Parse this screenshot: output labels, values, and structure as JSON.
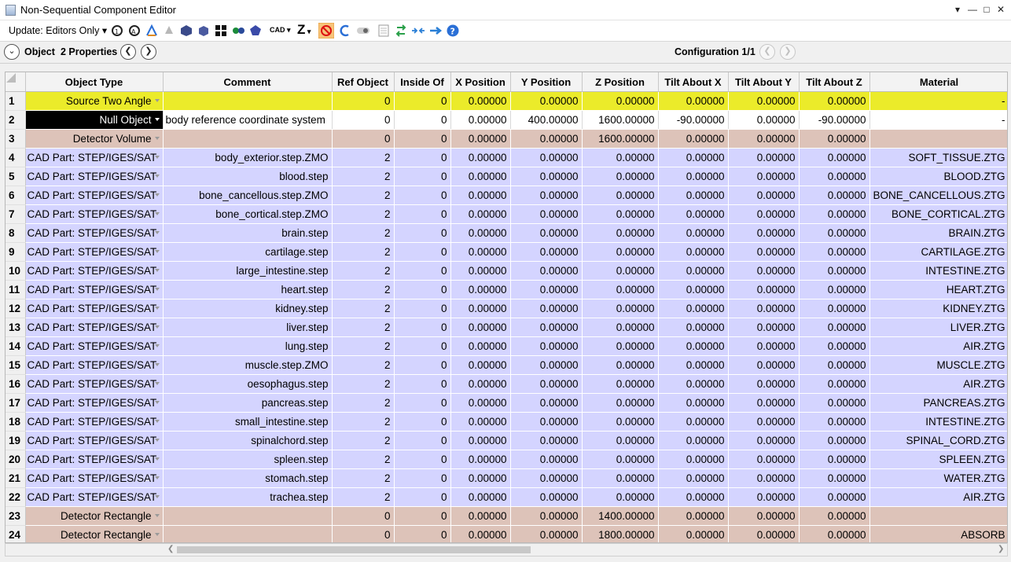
{
  "window": {
    "title": "Non-Sequential Component Editor"
  },
  "toolbar": {
    "update_label": "Update: Editors Only",
    "cad_label": "CAD",
    "z_label": "Z"
  },
  "configbar": {
    "object_label": "Object",
    "properties_label": "2 Properties",
    "configuration": "Configuration 1/1"
  },
  "columns": [
    "Object Type",
    "Comment",
    "Ref Object",
    "Inside Of",
    "X Position",
    "Y Position",
    "Z Position",
    "Tilt About X",
    "Tilt About Y",
    "Tilt About Z",
    "Material"
  ],
  "rows": [
    {
      "n": "1",
      "type": "Source Two Angle",
      "comment": "",
      "ref": "0",
      "inside": "0",
      "x": "0.00000",
      "y": "0.00000",
      "z": "0.00000",
      "tx": "0.00000",
      "ty": "0.00000",
      "tz": "0.00000",
      "mat": "-"
    },
    {
      "n": "2",
      "type": "Null Object",
      "comment": "body reference coordinate system",
      "ref": "0",
      "inside": "0",
      "x": "0.00000",
      "y": "400.00000",
      "z": "1600.00000",
      "tx": "-90.00000",
      "ty": "0.00000",
      "tz": "-90.00000",
      "mat": "-"
    },
    {
      "n": "3",
      "type": "Detector Volume",
      "comment": "",
      "ref": "0",
      "inside": "0",
      "x": "0.00000",
      "y": "0.00000",
      "z": "1600.00000",
      "tx": "0.00000",
      "ty": "0.00000",
      "tz": "0.00000",
      "mat": ""
    },
    {
      "n": "4",
      "type": "CAD Part: STEP/IGES/SAT",
      "comment": "body_exterior.step.ZMO",
      "ref": "2",
      "inside": "0",
      "x": "0.00000",
      "y": "0.00000",
      "z": "0.00000",
      "tx": "0.00000",
      "ty": "0.00000",
      "tz": "0.00000",
      "mat": "SOFT_TISSUE.ZTG"
    },
    {
      "n": "5",
      "type": "CAD Part: STEP/IGES/SAT",
      "comment": "blood.step",
      "ref": "2",
      "inside": "0",
      "x": "0.00000",
      "y": "0.00000",
      "z": "0.00000",
      "tx": "0.00000",
      "ty": "0.00000",
      "tz": "0.00000",
      "mat": "BLOOD.ZTG"
    },
    {
      "n": "6",
      "type": "CAD Part: STEP/IGES/SAT",
      "comment": "bone_cancellous.step.ZMO",
      "ref": "2",
      "inside": "0",
      "x": "0.00000",
      "y": "0.00000",
      "z": "0.00000",
      "tx": "0.00000",
      "ty": "0.00000",
      "tz": "0.00000",
      "mat": "BONE_CANCELLOUS.ZTG"
    },
    {
      "n": "7",
      "type": "CAD Part: STEP/IGES/SAT",
      "comment": "bone_cortical.step.ZMO",
      "ref": "2",
      "inside": "0",
      "x": "0.00000",
      "y": "0.00000",
      "z": "0.00000",
      "tx": "0.00000",
      "ty": "0.00000",
      "tz": "0.00000",
      "mat": "BONE_CORTICAL.ZTG"
    },
    {
      "n": "8",
      "type": "CAD Part: STEP/IGES/SAT",
      "comment": "brain.step",
      "ref": "2",
      "inside": "0",
      "x": "0.00000",
      "y": "0.00000",
      "z": "0.00000",
      "tx": "0.00000",
      "ty": "0.00000",
      "tz": "0.00000",
      "mat": "BRAIN.ZTG"
    },
    {
      "n": "9",
      "type": "CAD Part: STEP/IGES/SAT",
      "comment": "cartilage.step",
      "ref": "2",
      "inside": "0",
      "x": "0.00000",
      "y": "0.00000",
      "z": "0.00000",
      "tx": "0.00000",
      "ty": "0.00000",
      "tz": "0.00000",
      "mat": "CARTILAGE.ZTG"
    },
    {
      "n": "10",
      "type": "CAD Part: STEP/IGES/SAT",
      "comment": "large_intestine.step",
      "ref": "2",
      "inside": "0",
      "x": "0.00000",
      "y": "0.00000",
      "z": "0.00000",
      "tx": "0.00000",
      "ty": "0.00000",
      "tz": "0.00000",
      "mat": "INTESTINE.ZTG"
    },
    {
      "n": "11",
      "type": "CAD Part: STEP/IGES/SAT",
      "comment": "heart.step",
      "ref": "2",
      "inside": "0",
      "x": "0.00000",
      "y": "0.00000",
      "z": "0.00000",
      "tx": "0.00000",
      "ty": "0.00000",
      "tz": "0.00000",
      "mat": "HEART.ZTG"
    },
    {
      "n": "12",
      "type": "CAD Part: STEP/IGES/SAT",
      "comment": "kidney.step",
      "ref": "2",
      "inside": "0",
      "x": "0.00000",
      "y": "0.00000",
      "z": "0.00000",
      "tx": "0.00000",
      "ty": "0.00000",
      "tz": "0.00000",
      "mat": "KIDNEY.ZTG"
    },
    {
      "n": "13",
      "type": "CAD Part: STEP/IGES/SAT",
      "comment": "liver.step",
      "ref": "2",
      "inside": "0",
      "x": "0.00000",
      "y": "0.00000",
      "z": "0.00000",
      "tx": "0.00000",
      "ty": "0.00000",
      "tz": "0.00000",
      "mat": "LIVER.ZTG"
    },
    {
      "n": "14",
      "type": "CAD Part: STEP/IGES/SAT",
      "comment": "lung.step",
      "ref": "2",
      "inside": "0",
      "x": "0.00000",
      "y": "0.00000",
      "z": "0.00000",
      "tx": "0.00000",
      "ty": "0.00000",
      "tz": "0.00000",
      "mat": "AIR.ZTG"
    },
    {
      "n": "15",
      "type": "CAD Part: STEP/IGES/SAT",
      "comment": "muscle.step.ZMO",
      "ref": "2",
      "inside": "0",
      "x": "0.00000",
      "y": "0.00000",
      "z": "0.00000",
      "tx": "0.00000",
      "ty": "0.00000",
      "tz": "0.00000",
      "mat": "MUSCLE.ZTG"
    },
    {
      "n": "16",
      "type": "CAD Part: STEP/IGES/SAT",
      "comment": "oesophagus.step",
      "ref": "2",
      "inside": "0",
      "x": "0.00000",
      "y": "0.00000",
      "z": "0.00000",
      "tx": "0.00000",
      "ty": "0.00000",
      "tz": "0.00000",
      "mat": "AIR.ZTG"
    },
    {
      "n": "17",
      "type": "CAD Part: STEP/IGES/SAT",
      "comment": "pancreas.step",
      "ref": "2",
      "inside": "0",
      "x": "0.00000",
      "y": "0.00000",
      "z": "0.00000",
      "tx": "0.00000",
      "ty": "0.00000",
      "tz": "0.00000",
      "mat": "PANCREAS.ZTG"
    },
    {
      "n": "18",
      "type": "CAD Part: STEP/IGES/SAT",
      "comment": "small_intestine.step",
      "ref": "2",
      "inside": "0",
      "x": "0.00000",
      "y": "0.00000",
      "z": "0.00000",
      "tx": "0.00000",
      "ty": "0.00000",
      "tz": "0.00000",
      "mat": "INTESTINE.ZTG"
    },
    {
      "n": "19",
      "type": "CAD Part: STEP/IGES/SAT",
      "comment": "spinalchord.step",
      "ref": "2",
      "inside": "0",
      "x": "0.00000",
      "y": "0.00000",
      "z": "0.00000",
      "tx": "0.00000",
      "ty": "0.00000",
      "tz": "0.00000",
      "mat": "SPINAL_CORD.ZTG"
    },
    {
      "n": "20",
      "type": "CAD Part: STEP/IGES/SAT",
      "comment": "spleen.step",
      "ref": "2",
      "inside": "0",
      "x": "0.00000",
      "y": "0.00000",
      "z": "0.00000",
      "tx": "0.00000",
      "ty": "0.00000",
      "tz": "0.00000",
      "mat": "SPLEEN.ZTG"
    },
    {
      "n": "21",
      "type": "CAD Part: STEP/IGES/SAT",
      "comment": "stomach.step",
      "ref": "2",
      "inside": "0",
      "x": "0.00000",
      "y": "0.00000",
      "z": "0.00000",
      "tx": "0.00000",
      "ty": "0.00000",
      "tz": "0.00000",
      "mat": "WATER.ZTG"
    },
    {
      "n": "22",
      "type": "CAD Part: STEP/IGES/SAT",
      "comment": "trachea.step",
      "ref": "2",
      "inside": "0",
      "x": "0.00000",
      "y": "0.00000",
      "z": "0.00000",
      "tx": "0.00000",
      "ty": "0.00000",
      "tz": "0.00000",
      "mat": "AIR.ZTG"
    },
    {
      "n": "23",
      "type": "Detector Rectangle",
      "comment": "",
      "ref": "0",
      "inside": "0",
      "x": "0.00000",
      "y": "0.00000",
      "z": "1400.00000",
      "tx": "0.00000",
      "ty": "0.00000",
      "tz": "0.00000",
      "mat": ""
    },
    {
      "n": "24",
      "type": "Detector Rectangle",
      "comment": "",
      "ref": "0",
      "inside": "0",
      "x": "0.00000",
      "y": "0.00000",
      "z": "1800.00000",
      "tx": "0.00000",
      "ty": "0.00000",
      "tz": "0.00000",
      "mat": "ABSORB"
    }
  ],
  "colors": {
    "source": "#ebeb2a",
    "detector": "#ddc3b9",
    "cad": "#d4d4ff",
    "selected": "#000000"
  }
}
